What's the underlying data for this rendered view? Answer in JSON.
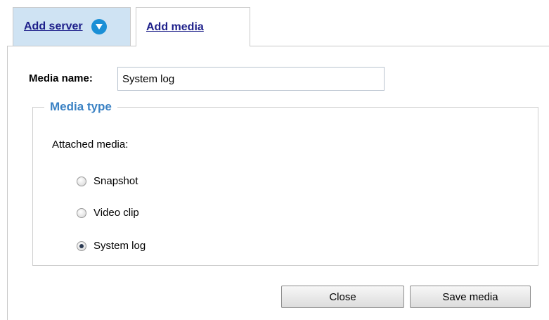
{
  "tabs": {
    "add_server": "Add server",
    "add_media": "Add media"
  },
  "form": {
    "media_name_label": "Media name:",
    "media_name_value": "System log"
  },
  "media_type": {
    "legend": "Media type",
    "attached_label": "Attached media:",
    "options": [
      {
        "label": "Snapshot",
        "selected": false
      },
      {
        "label": "Video clip",
        "selected": false
      },
      {
        "label": "System log",
        "selected": true
      }
    ]
  },
  "buttons": {
    "close": "Close",
    "save": "Save media"
  },
  "icons": {
    "dropdown": "chevron-down-circle-icon",
    "radio_selected": "radio-selected-icon",
    "radio_unselected": "radio-unselected-icon"
  },
  "colors": {
    "tab_active_bg": "#cfe3f3",
    "link": "#1d1f8a",
    "legend": "#3b82c4",
    "dropdown_icon": "#1a8fd6"
  }
}
